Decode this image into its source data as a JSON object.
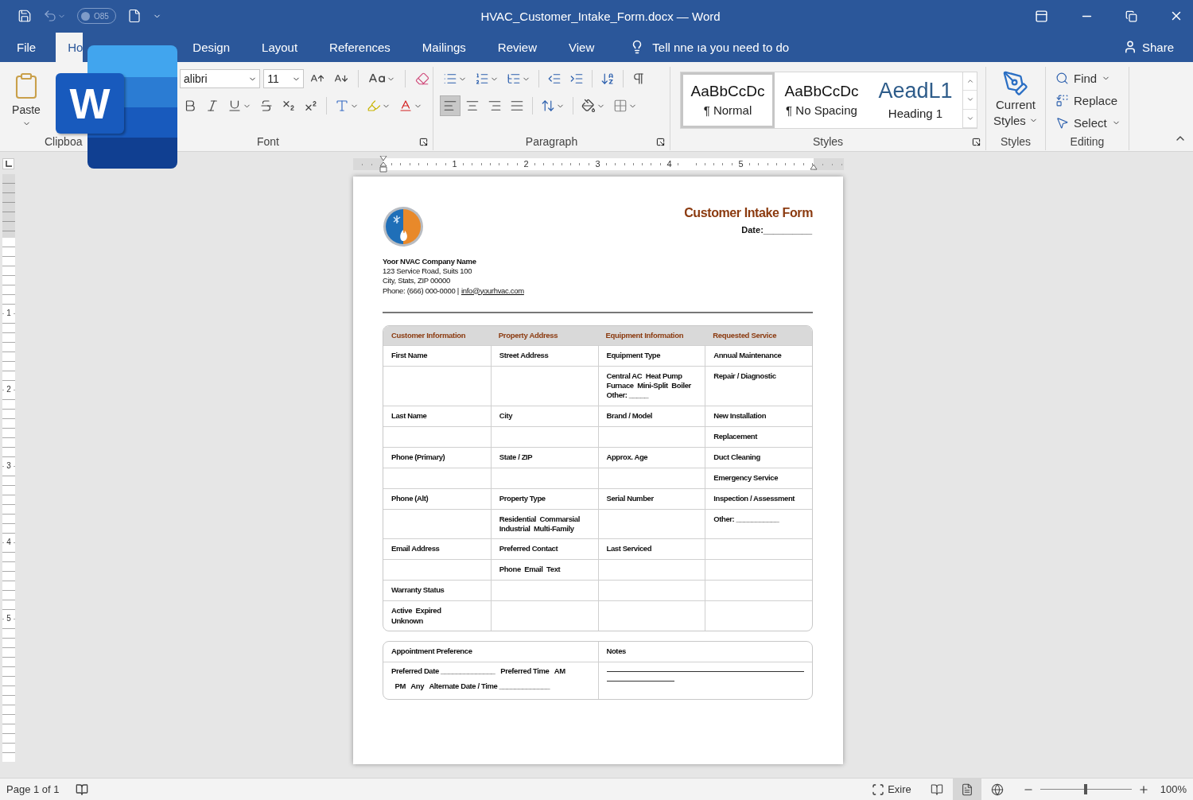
{
  "window": {
    "title": "HVAC_Customer_Intake_Form.docx — Word",
    "autosave": "O85"
  },
  "tabs": [
    {
      "label": "File",
      "selected": false
    },
    {
      "label": "Ho",
      "selected": true
    },
    {
      "label": "Design",
      "selected": false
    },
    {
      "label": "Layout",
      "selected": false
    },
    {
      "label": "References",
      "selected": false
    },
    {
      "label": "Mailings",
      "selected": false
    },
    {
      "label": "Review",
      "selected": false
    },
    {
      "label": "View",
      "selected": false
    }
  ],
  "tell_me": "Tell nne ıa you need to do",
  "share": "Share",
  "app_logo": "W",
  "ribbon": {
    "clipboard": {
      "paste": "Paste",
      "label": "Clipboa"
    },
    "font": {
      "name": "alibri",
      "size": "11",
      "label": "Font"
    },
    "paragraph": {
      "label": "Paragraph",
      "alignments": [
        {
          "kind": "left",
          "selected": true
        },
        {
          "kind": "center",
          "selected": false
        },
        {
          "kind": "right",
          "selected": false
        },
        {
          "kind": "justify",
          "selected": false
        }
      ]
    },
    "styles": {
      "label": "Styles",
      "gallery": [
        {
          "kind": "body",
          "preview": "AaBbCcDc",
          "name": "¶ Normal",
          "selected": true
        },
        {
          "kind": "body",
          "preview": "AaBbCcDc",
          "name": "¶ No Spacing",
          "selected": false
        },
        {
          "kind": "heading",
          "preview": "AeadL1",
          "name": "Heading 1",
          "selected": false
        }
      ]
    },
    "current_styles": {
      "button": "Current Styles",
      "label": "Styles"
    },
    "editing": {
      "label": "Editing",
      "items": [
        {
          "kind": "find",
          "label": "Find"
        },
        {
          "kind": "replace",
          "label": "Replace"
        },
        {
          "kind": "select",
          "label": "Select"
        }
      ]
    }
  },
  "ruler": {
    "numbers": [
      "1",
      "2",
      "3",
      "4",
      "5"
    ]
  },
  "vertical_ruler": {
    "numbers": [
      "1",
      "2",
      "3",
      "4",
      "5"
    ]
  },
  "document": {
    "title": "Customer Intake Form",
    "date": "Date:__________",
    "company": [
      "Yoor NVAC Company Name",
      "123 Service Road, Suits 100",
      "City, Stats, ZIP 00000"
    ],
    "phone": "Phone: (666) 000-0000 |",
    "email": "info@yourhvac.com",
    "table": {
      "columns": [
        "Customer Information",
        "Property Address",
        "Equipment Information",
        "Requested Service"
      ],
      "rows": [
        [
          "First Name",
          "Street Address",
          "Equipment Type",
          "Annual Maintenance"
        ],
        [
          "",
          "",
          "Central AC  Heat Pump\nFurnace  Mini-Split  Boiler\nOther: _____",
          "Repair / Diagnostic"
        ],
        [
          "Last Name",
          "City",
          "Brand / Model",
          "New Installation"
        ],
        [
          "",
          "",
          "",
          "Replacement"
        ],
        [
          "Phone (Primary)",
          "State / ZIP",
          "Approx. Age",
          "Duct Cleaning"
        ],
        [
          "",
          "",
          "",
          "Emergency Service"
        ],
        [
          "Phone (Alt)",
          "Property Type",
          "Serial Number",
          "Inspection / Assessment"
        ],
        [
          "",
          "Residential  Commarsial\nIndustrial  Multi-Family",
          "",
          "Other: ___________"
        ],
        [
          "Email Address",
          "Preferred Contact",
          "Last Serviced",
          ""
        ],
        [
          "",
          "Phone  Email  Text",
          "",
          ""
        ],
        [
          "Warranty Status",
          "",
          "",
          ""
        ],
        [
          "Active  Expired\nUnknown",
          "",
          "",
          ""
        ]
      ]
    },
    "appointment": {
      "title": "Appointment Preference",
      "lines": [
        "Preferred Date ______________   Preferred Time   AM",
        "  PM   Any   Alternate Date / Time _____________"
      ]
    },
    "notes": {
      "title": "Notes"
    }
  },
  "status": {
    "page": "Page 1 of 1",
    "focus": "Exire",
    "views": [
      {
        "kind": "read",
        "selected": false
      },
      {
        "kind": "print",
        "selected": true
      },
      {
        "kind": "web",
        "selected": false
      }
    ],
    "zoom": {
      "level": 0.5,
      "reading": "100%"
    }
  }
}
